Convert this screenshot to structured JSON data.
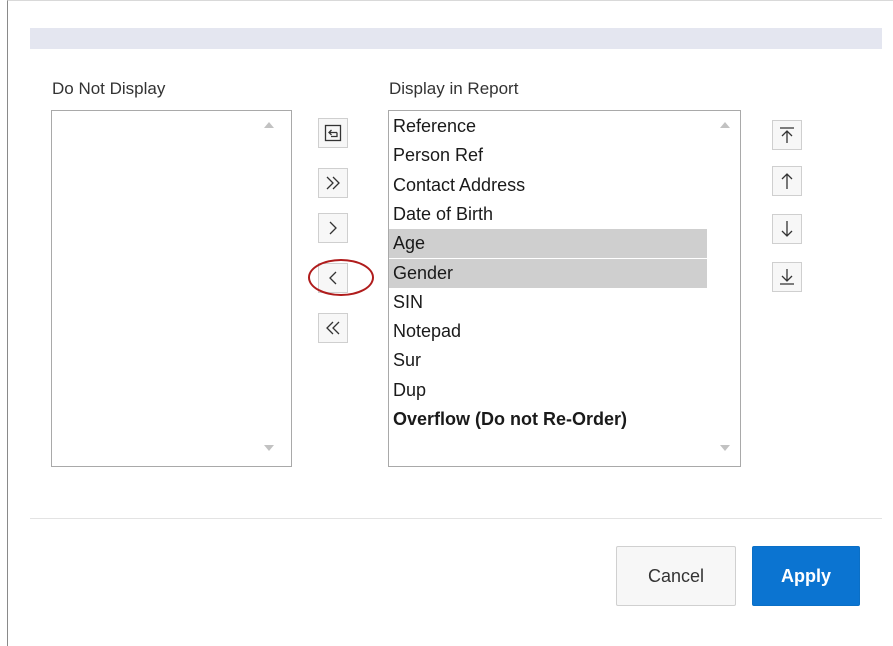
{
  "left_panel": {
    "label": "Do Not Display",
    "items": []
  },
  "right_panel": {
    "label": "Display in Report",
    "items": [
      {
        "text": "Reference",
        "selected": false,
        "bold": false
      },
      {
        "text": "Person Ref",
        "selected": false,
        "bold": false
      },
      {
        "text": "Contact Address",
        "selected": false,
        "bold": false
      },
      {
        "text": "Date of Birth",
        "selected": false,
        "bold": false
      },
      {
        "text": "Age",
        "selected": true,
        "bold": false
      },
      {
        "text": "Gender",
        "selected": true,
        "bold": false
      },
      {
        "text": "SIN",
        "selected": false,
        "bold": false
      },
      {
        "text": "Notepad",
        "selected": false,
        "bold": false
      },
      {
        "text": "Sur",
        "selected": false,
        "bold": false
      },
      {
        "text": "Dup",
        "selected": false,
        "bold": false
      },
      {
        "text": "Overflow (Do not Re-Order)",
        "selected": false,
        "bold": true
      }
    ]
  },
  "shuttle_buttons": [
    {
      "name": "reset-button",
      "icon": "reset-icon"
    },
    {
      "name": "move-all-right-button",
      "icon": "double-chevron-right-icon"
    },
    {
      "name": "move-right-button",
      "icon": "chevron-right-icon"
    },
    {
      "name": "move-left-button",
      "icon": "chevron-left-icon"
    },
    {
      "name": "move-all-left-button",
      "icon": "double-chevron-left-icon"
    }
  ],
  "order_buttons": [
    {
      "name": "move-top-button",
      "icon": "arrow-to-top-icon"
    },
    {
      "name": "move-up-button",
      "icon": "arrow-up-icon"
    },
    {
      "name": "move-down-button",
      "icon": "arrow-down-icon"
    },
    {
      "name": "move-bottom-button",
      "icon": "arrow-to-bottom-icon"
    }
  ],
  "footer": {
    "cancel_label": "Cancel",
    "apply_label": "Apply"
  },
  "colors": {
    "accent": "#0b74d1",
    "selection": "#cfcfcf",
    "annotation": "#b01c1c"
  }
}
